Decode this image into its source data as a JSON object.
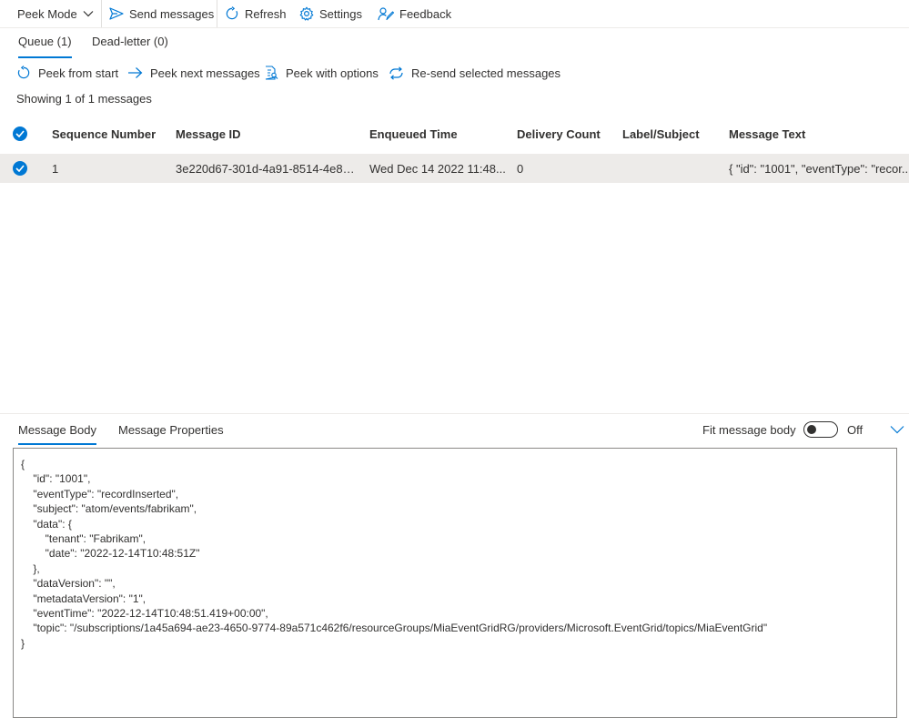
{
  "toolbar": {
    "peek_mode": "Peek Mode",
    "send_messages": "Send messages",
    "refresh": "Refresh",
    "settings": "Settings",
    "feedback": "Feedback"
  },
  "tabs": {
    "queue": "Queue (1)",
    "dead_letter": "Dead-letter (0)"
  },
  "actions": {
    "peek_from_start": "Peek from start",
    "peek_next": "Peek next messages",
    "peek_with_options": "Peek with options",
    "resend": "Re-send selected messages"
  },
  "showing": "Showing 1 of 1 messages",
  "table": {
    "headers": {
      "sequence_number": "Sequence Number",
      "message_id": "Message ID",
      "enqueued_time": "Enqueued Time",
      "delivery_count": "Delivery Count",
      "label_subject": "Label/Subject",
      "message_text": "Message Text"
    },
    "rows": [
      {
        "selected": true,
        "sequence_number": "1",
        "message_id": "3e220d67-301d-4a91-8514-4e8c...",
        "enqueued_time": "Wed Dec 14 2022 11:48...",
        "delivery_count": "0",
        "label_subject": "",
        "message_text": "{ \"id\": \"1001\", \"eventType\": \"recor..."
      }
    ]
  },
  "bottom": {
    "tab_body": "Message Body",
    "tab_properties": "Message Properties",
    "fit_label": "Fit message body",
    "toggle_state": "Off",
    "body_lines": [
      "{",
      "    \"id\": \"1001\",",
      "    \"eventType\": \"recordInserted\",",
      "    \"subject\": \"atom/events/fabrikam\",",
      "    \"data\": {",
      "        \"tenant\": \"Fabrikam\",",
      "        \"date\": \"2022-12-14T10:48:51Z\"",
      "    },",
      "    \"dataVersion\": \"\",",
      "    \"metadataVersion\": \"1\",",
      "    \"eventTime\": \"2022-12-14T10:48:51.419+00:00\",",
      "    \"topic\": \"/subscriptions/1a45a694-ae23-4650-9774-89a571c462f6/resourceGroups/MiaEventGridRG/providers/Microsoft.EventGrid/topics/MiaEventGrid\"",
      "}"
    ]
  },
  "icons": {
    "chevron": "chevron-down-icon",
    "send": "send-icon",
    "refresh": "refresh-icon",
    "settings": "gear-icon",
    "feedback": "feedback-icon",
    "check": "checkmark-circle-icon"
  },
  "colors": {
    "accent": "#0078d4",
    "row_selected": "#edebe9",
    "text": "#323130"
  }
}
